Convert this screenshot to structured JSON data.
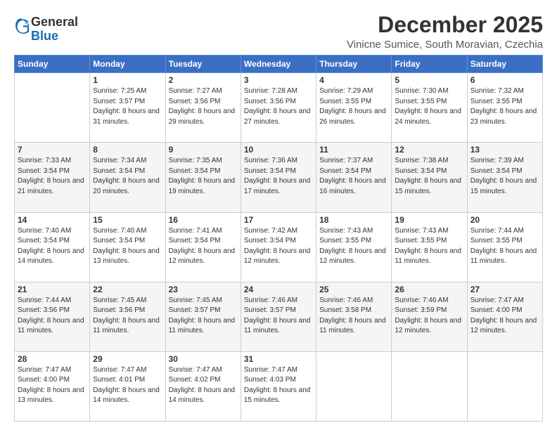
{
  "logo": {
    "general": "General",
    "blue": "Blue"
  },
  "title": "December 2025",
  "location": "Vinicne Sumice, South Moravian, Czechia",
  "days_of_week": [
    "Sunday",
    "Monday",
    "Tuesday",
    "Wednesday",
    "Thursday",
    "Friday",
    "Saturday"
  ],
  "weeks": [
    [
      {
        "day": null,
        "sunrise": null,
        "sunset": null,
        "daylight": null
      },
      {
        "day": "1",
        "sunrise": "7:25 AM",
        "sunset": "3:57 PM",
        "daylight": "8 hours and 31 minutes."
      },
      {
        "day": "2",
        "sunrise": "7:27 AM",
        "sunset": "3:56 PM",
        "daylight": "8 hours and 29 minutes."
      },
      {
        "day": "3",
        "sunrise": "7:28 AM",
        "sunset": "3:56 PM",
        "daylight": "8 hours and 27 minutes."
      },
      {
        "day": "4",
        "sunrise": "7:29 AM",
        "sunset": "3:55 PM",
        "daylight": "8 hours and 26 minutes."
      },
      {
        "day": "5",
        "sunrise": "7:30 AM",
        "sunset": "3:55 PM",
        "daylight": "8 hours and 24 minutes."
      },
      {
        "day": "6",
        "sunrise": "7:32 AM",
        "sunset": "3:55 PM",
        "daylight": "8 hours and 23 minutes."
      }
    ],
    [
      {
        "day": "7",
        "sunrise": "7:33 AM",
        "sunset": "3:54 PM",
        "daylight": "8 hours and 21 minutes."
      },
      {
        "day": "8",
        "sunrise": "7:34 AM",
        "sunset": "3:54 PM",
        "daylight": "8 hours and 20 minutes."
      },
      {
        "day": "9",
        "sunrise": "7:35 AM",
        "sunset": "3:54 PM",
        "daylight": "8 hours and 19 minutes."
      },
      {
        "day": "10",
        "sunrise": "7:36 AM",
        "sunset": "3:54 PM",
        "daylight": "8 hours and 17 minutes."
      },
      {
        "day": "11",
        "sunrise": "7:37 AM",
        "sunset": "3:54 PM",
        "daylight": "8 hours and 16 minutes."
      },
      {
        "day": "12",
        "sunrise": "7:38 AM",
        "sunset": "3:54 PM",
        "daylight": "8 hours and 15 minutes."
      },
      {
        "day": "13",
        "sunrise": "7:39 AM",
        "sunset": "3:54 PM",
        "daylight": "8 hours and 15 minutes."
      }
    ],
    [
      {
        "day": "14",
        "sunrise": "7:40 AM",
        "sunset": "3:54 PM",
        "daylight": "8 hours and 14 minutes."
      },
      {
        "day": "15",
        "sunrise": "7:40 AM",
        "sunset": "3:54 PM",
        "daylight": "8 hours and 13 minutes."
      },
      {
        "day": "16",
        "sunrise": "7:41 AM",
        "sunset": "3:54 PM",
        "daylight": "8 hours and 12 minutes."
      },
      {
        "day": "17",
        "sunrise": "7:42 AM",
        "sunset": "3:54 PM",
        "daylight": "8 hours and 12 minutes."
      },
      {
        "day": "18",
        "sunrise": "7:43 AM",
        "sunset": "3:55 PM",
        "daylight": "8 hours and 12 minutes."
      },
      {
        "day": "19",
        "sunrise": "7:43 AM",
        "sunset": "3:55 PM",
        "daylight": "8 hours and 11 minutes."
      },
      {
        "day": "20",
        "sunrise": "7:44 AM",
        "sunset": "3:55 PM",
        "daylight": "8 hours and 11 minutes."
      }
    ],
    [
      {
        "day": "21",
        "sunrise": "7:44 AM",
        "sunset": "3:56 PM",
        "daylight": "8 hours and 11 minutes."
      },
      {
        "day": "22",
        "sunrise": "7:45 AM",
        "sunset": "3:56 PM",
        "daylight": "8 hours and 11 minutes."
      },
      {
        "day": "23",
        "sunrise": "7:45 AM",
        "sunset": "3:57 PM",
        "daylight": "8 hours and 11 minutes."
      },
      {
        "day": "24",
        "sunrise": "7:46 AM",
        "sunset": "3:57 PM",
        "daylight": "8 hours and 11 minutes."
      },
      {
        "day": "25",
        "sunrise": "7:46 AM",
        "sunset": "3:58 PM",
        "daylight": "8 hours and 11 minutes."
      },
      {
        "day": "26",
        "sunrise": "7:46 AM",
        "sunset": "3:59 PM",
        "daylight": "8 hours and 12 minutes."
      },
      {
        "day": "27",
        "sunrise": "7:47 AM",
        "sunset": "4:00 PM",
        "daylight": "8 hours and 12 minutes."
      }
    ],
    [
      {
        "day": "28",
        "sunrise": "7:47 AM",
        "sunset": "4:00 PM",
        "daylight": "8 hours and 13 minutes."
      },
      {
        "day": "29",
        "sunrise": "7:47 AM",
        "sunset": "4:01 PM",
        "daylight": "8 hours and 14 minutes."
      },
      {
        "day": "30",
        "sunrise": "7:47 AM",
        "sunset": "4:02 PM",
        "daylight": "8 hours and 14 minutes."
      },
      {
        "day": "31",
        "sunrise": "7:47 AM",
        "sunset": "4:03 PM",
        "daylight": "8 hours and 15 minutes."
      },
      {
        "day": null,
        "sunrise": null,
        "sunset": null,
        "daylight": null
      },
      {
        "day": null,
        "sunrise": null,
        "sunset": null,
        "daylight": null
      },
      {
        "day": null,
        "sunrise": null,
        "sunset": null,
        "daylight": null
      }
    ]
  ]
}
